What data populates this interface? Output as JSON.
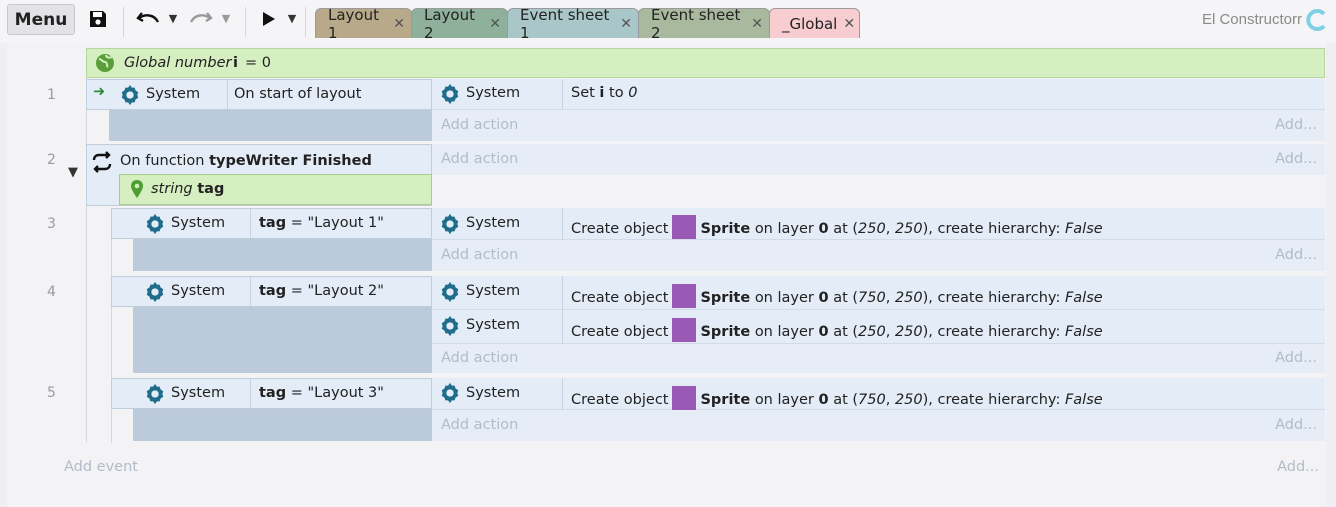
{
  "toolbar": {
    "menu_label": "Menu",
    "tabs": [
      {
        "label": "Layout 1",
        "color": "#b8a98a"
      },
      {
        "label": "Layout 2",
        "color": "#8fb09a"
      },
      {
        "label": "Event sheet 1",
        "color": "#a9c7c9"
      },
      {
        "label": "Event sheet 2",
        "color": "#a9b99d"
      },
      {
        "label": "_Global",
        "color": "#f7cdd2"
      }
    ],
    "brand": "El Constructorr"
  },
  "sheet": {
    "global_var": {
      "prefix": "Global number",
      "name": "i",
      "value": "= 0"
    },
    "line_numbers": [
      "1",
      "2",
      "3",
      "4",
      "5"
    ],
    "event1": {
      "object": "System",
      "condition": "On start of layout",
      "action_object": "System",
      "action_set": "Set",
      "action_var": "i",
      "action_to": "to",
      "action_value": "0"
    },
    "event2": {
      "prefix": "On function",
      "name": "typeWriter Finished",
      "param_type": "string",
      "param_name": "tag"
    },
    "sub_events": [
      {
        "object": "System",
        "var": "tag",
        "op": "=",
        "value": "\"Layout 1\"",
        "actions": [
          {
            "object": "System",
            "create": "Create object",
            "sprite": "Sprite",
            "onlayer": "on layer",
            "layer": "0",
            "at": "at (",
            "x": "250",
            "comma": ", ",
            "y": "250",
            "tail": "), create hierarchy:",
            "hier": "False"
          }
        ]
      },
      {
        "object": "System",
        "var": "tag",
        "op": "=",
        "value": "\"Layout 2\"",
        "actions": [
          {
            "object": "System",
            "create": "Create object",
            "sprite": "Sprite",
            "onlayer": "on layer",
            "layer": "0",
            "at": "at (",
            "x": "750",
            "comma": ", ",
            "y": "250",
            "tail": "), create hierarchy:",
            "hier": "False"
          },
          {
            "object": "System",
            "create": "Create object",
            "sprite": "Sprite",
            "onlayer": "on layer",
            "layer": "0",
            "at": "at (",
            "x": "250",
            "comma": ", ",
            "y": "250",
            "tail": "), create hierarchy:",
            "hier": "False"
          }
        ]
      },
      {
        "object": "System",
        "var": "tag",
        "op": "=",
        "value": "\"Layout 3\"",
        "actions": [
          {
            "object": "System",
            "create": "Create object",
            "sprite": "Sprite",
            "onlayer": "on layer",
            "layer": "0",
            "at": "at (",
            "x": "750",
            "comma": ", ",
            "y": "250",
            "tail": "), create hierarchy:",
            "hier": "False"
          }
        ]
      }
    ],
    "add_action": "Add action",
    "add_more": "Add...",
    "add_event": "Add event"
  }
}
